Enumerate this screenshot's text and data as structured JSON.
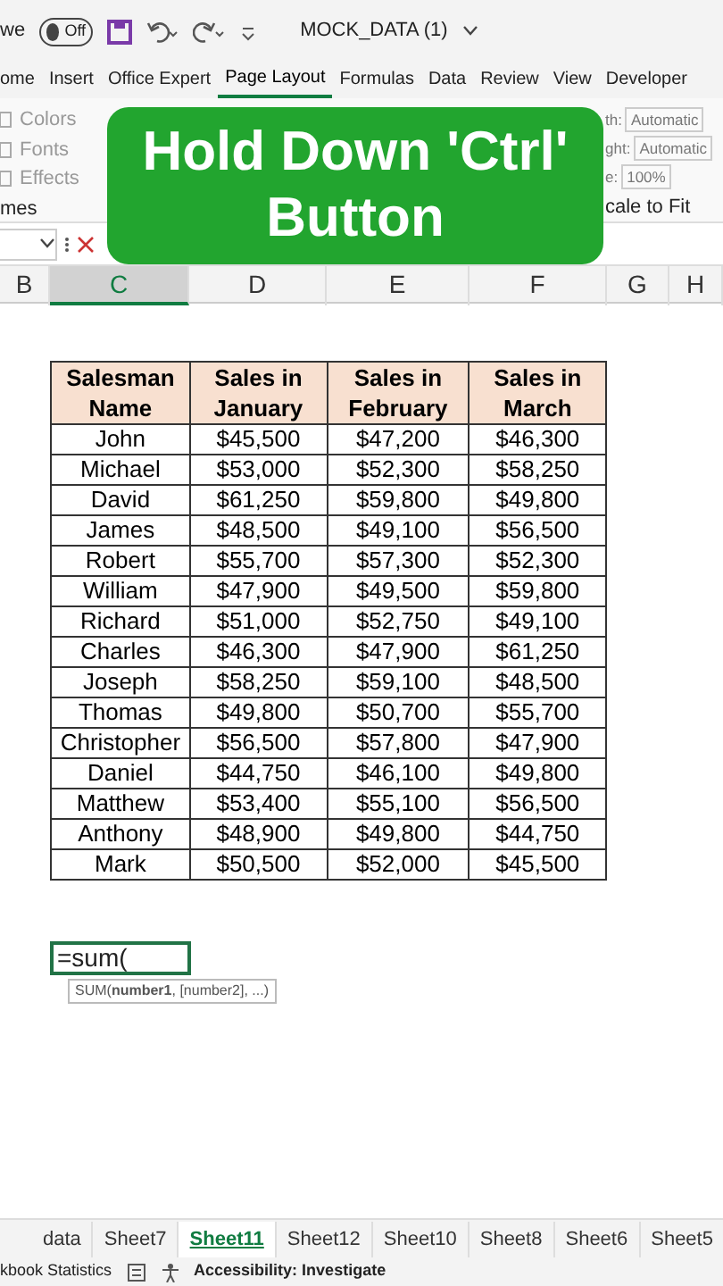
{
  "title_bar": {
    "autosave_label": "we",
    "autosave_toggle": {
      "label": "Off",
      "on": false
    },
    "file_name": "MOCK_DATA (1)"
  },
  "ribbon_tabs": [
    {
      "label": "ome",
      "selected": false
    },
    {
      "label": "Insert",
      "selected": false
    },
    {
      "label": "Office Expert",
      "selected": false
    },
    {
      "label": "Page Layout",
      "selected": true
    },
    {
      "label": "Formulas",
      "selected": false
    },
    {
      "label": "Data",
      "selected": false
    },
    {
      "label": "Review",
      "selected": false
    },
    {
      "label": "View",
      "selected": false
    },
    {
      "label": "Developer",
      "selected": false
    }
  ],
  "ribbon": {
    "themes_items": [
      "Colors",
      "Fonts",
      "Effects"
    ],
    "themes_group": "mes",
    "scale_items": [
      {
        "label": "th:",
        "value": "Automatic"
      },
      {
        "label": "ght:",
        "value": "Automatic"
      },
      {
        "label": "e:",
        "value": "100%"
      }
    ],
    "scale_group": "cale to Fit"
  },
  "overlay": {
    "lines": [
      "Hold Down 'Ctrl'",
      "Button"
    ]
  },
  "column_headers": [
    {
      "label": "B",
      "selected": false
    },
    {
      "label": "C",
      "selected": true
    },
    {
      "label": "D",
      "selected": false
    },
    {
      "label": "E",
      "selected": false
    },
    {
      "label": "F",
      "selected": false
    },
    {
      "label": "G",
      "selected": false
    },
    {
      "label": "H",
      "selected": false
    }
  ],
  "table": {
    "columns": [
      "Salesman Name",
      "Sales in January",
      "Sales in February",
      "Sales in March"
    ],
    "rows": [
      [
        "John",
        "$45,500",
        "$47,200",
        "$46,300"
      ],
      [
        "Michael",
        "$53,000",
        "$52,300",
        "$58,250"
      ],
      [
        "David",
        "$61,250",
        "$59,800",
        "$49,800"
      ],
      [
        "James",
        "$48,500",
        "$49,100",
        "$56,500"
      ],
      [
        "Robert",
        "$55,700",
        "$57,300",
        "$52,300"
      ],
      [
        "William",
        "$47,900",
        "$49,500",
        "$59,800"
      ],
      [
        "Richard",
        "$51,000",
        "$52,750",
        "$49,100"
      ],
      [
        "Charles",
        "$46,300",
        "$47,900",
        "$61,250"
      ],
      [
        "Joseph",
        "$58,250",
        "$59,100",
        "$48,500"
      ],
      [
        "Thomas",
        "$49,800",
        "$50,700",
        "$55,700"
      ],
      [
        "Christopher",
        "$56,500",
        "$57,800",
        "$47,900"
      ],
      [
        "Daniel",
        "$44,750",
        "$46,100",
        "$49,800"
      ],
      [
        "Matthew",
        "$53,400",
        "$55,100",
        "$56,500"
      ],
      [
        "Anthony",
        "$48,900",
        "$49,800",
        "$44,750"
      ],
      [
        "Mark",
        "$50,500",
        "$52,000",
        "$45,500"
      ]
    ]
  },
  "active_cell": {
    "value": "=sum(",
    "tooltip": "SUM(**number1**, [number2], ...)"
  },
  "sheet_tabs": [
    {
      "label": "data",
      "selected": false
    },
    {
      "label": "Sheet7",
      "selected": false
    },
    {
      "label": "Sheet11",
      "selected": true
    },
    {
      "label": "Sheet12",
      "selected": false
    },
    {
      "label": "Sheet10",
      "selected": false
    },
    {
      "label": "Sheet8",
      "selected": false
    },
    {
      "label": "Sheet6",
      "selected": false
    },
    {
      "label": "Sheet5",
      "selected": false
    }
  ],
  "status_bar": {
    "left": "kbook Statistics",
    "accessibility": "Accessibility: Investigate"
  }
}
